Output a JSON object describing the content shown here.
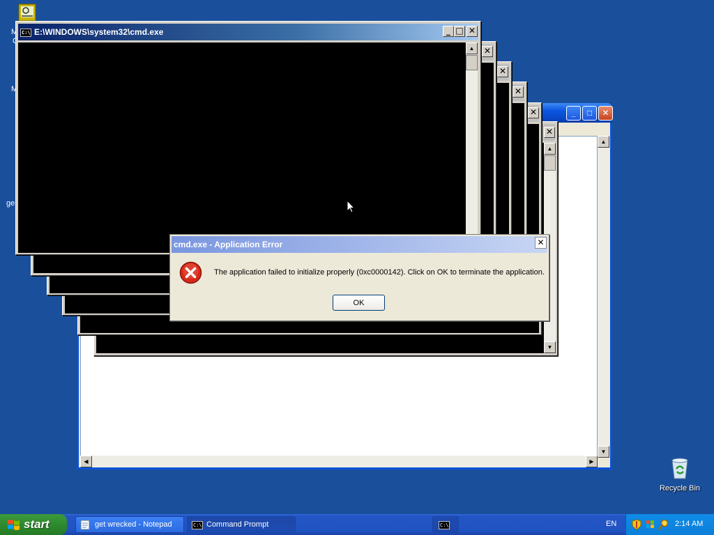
{
  "desktop": {
    "partial_labels": [
      "M",
      "C",
      "M",
      "ge"
    ],
    "recycle_bin_label": "Recycle Bin"
  },
  "notepad": {
    "title": "get wrecked - Notepad"
  },
  "cmd": {
    "title": "E:\\WINDOWS\\system32\\cmd.exe",
    "icon_text": "C:\\"
  },
  "error_dialog": {
    "title": "cmd.exe - Application Error",
    "message": "The application failed to initialize properly (0xc0000142). Click on OK to terminate the application.",
    "ok_label": "OK",
    "close_glyph": "✕",
    "icon": "error-x-icon"
  },
  "taskbar": {
    "start_label": "start",
    "buttons": [
      {
        "label": "get wrecked - Notepad",
        "icon": "notepad-icon"
      },
      {
        "label": "Command Prompt",
        "icon": "cmd-icon"
      },
      {
        "label": "",
        "icon": "cmd-icon"
      }
    ],
    "language": "EN",
    "clock": "2:14 AM"
  },
  "glyphs": {
    "minimize": "_",
    "maximize": "□",
    "close": "✕",
    "up": "▲",
    "down": "▼",
    "left": "◀",
    "right": "▶"
  }
}
